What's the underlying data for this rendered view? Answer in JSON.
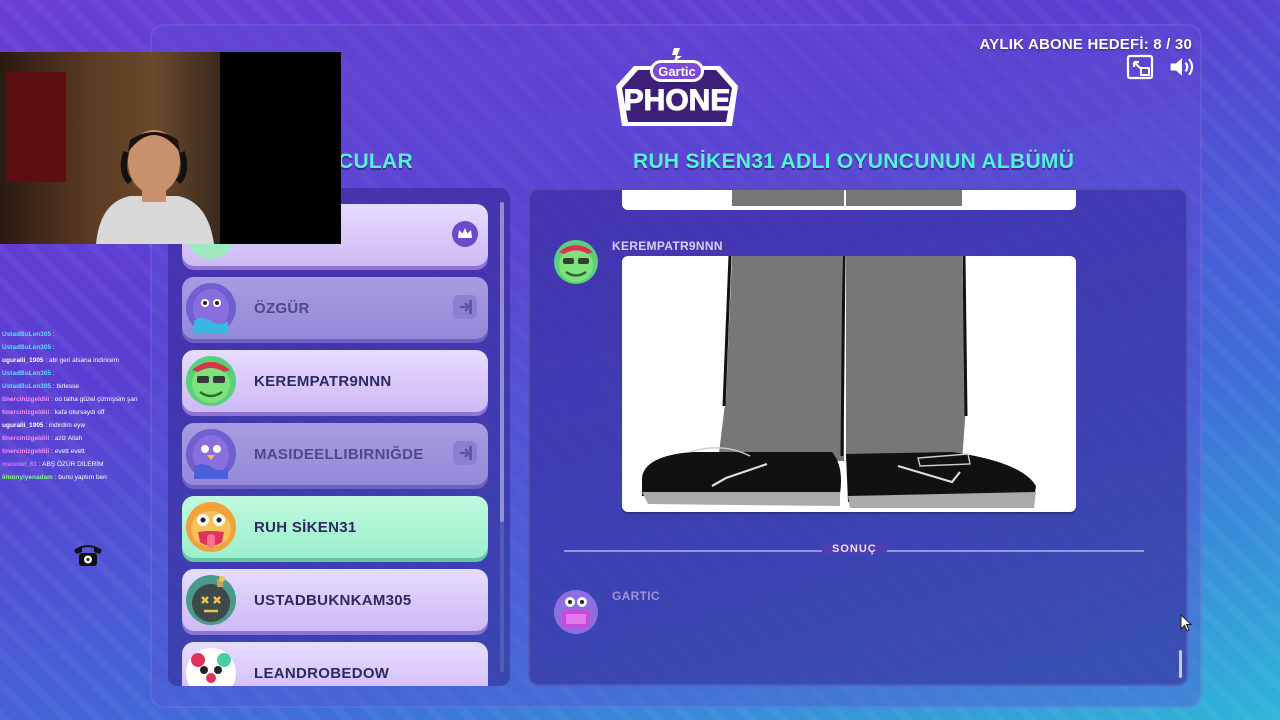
{
  "header": {
    "subscriber_goal": "AYLIK ABONE HEDEFİ: 8 / 30",
    "logo_top": "Gartic",
    "logo_bottom": "PHONE",
    "players_title": "CULAR",
    "album_title": "RUH SİKEN31 ADLI OYUNCUNUN ALBÜMÜ"
  },
  "players": [
    {
      "name": "",
      "state": "host"
    },
    {
      "name": "ÖZGÜR",
      "state": "left"
    },
    {
      "name": "KEREMPATR9NNN",
      "state": "normal"
    },
    {
      "name": "MASIDEELLIBIRNIĞDE",
      "state": "left"
    },
    {
      "name": "RUH SİKEN31",
      "state": "active"
    },
    {
      "name": "USTADBUKNKAM305",
      "state": "normal"
    },
    {
      "name": "LEANDROBEDOW",
      "state": "normal"
    }
  ],
  "album": {
    "entry_author": "KEREMPATR9NNN",
    "result_label": "SONUÇ",
    "result_author": "GARTIC"
  },
  "chat": [
    {
      "user": "UstadBuLen305",
      "msg": ":",
      "color": "#55e0ff"
    },
    {
      "user": "UstadBuLen305",
      "msg": ":",
      "color": "#55e0ff"
    },
    {
      "user": "uguralii_1905",
      "msg": ": abi geri alsana indiricem",
      "color": "#ffffff"
    },
    {
      "user": "UstadBuLen305",
      "msg": ":",
      "color": "#55e0ff"
    },
    {
      "user": "UstadBuLen305",
      "msg": ": birlesse",
      "color": "#55e0ff"
    },
    {
      "user": "tinercinizgeldiii",
      "msg": ": oo talha güzel çizmişsim şan",
      "color": "#ff8cff"
    },
    {
      "user": "tinercinizgeldiii",
      "msg": ": kafa otursaydı off",
      "color": "#ff8cff"
    },
    {
      "user": "uguralii_1905",
      "msg": ": indirdim eyw",
      "color": "#ffffff"
    },
    {
      "user": "tinercinizgeldiii",
      "msg": ": aziz Allah",
      "color": "#ff8cff"
    },
    {
      "user": "tinercinizgeldiii",
      "msg": ": evett evett",
      "color": "#ff8cff"
    },
    {
      "user": "masidel_61",
      "msg": ": ABŞ ÖZÜR DİLERİM",
      "color": "#c080ff"
    },
    {
      "user": "limonyiyenadam",
      "msg": ": bunu yaptım ben",
      "color": "#7dff7d"
    }
  ],
  "colors": {
    "accent_title": "#54f2d8",
    "active_player": "#9cf0cd",
    "player_card": "#e7dcff"
  },
  "icons": [
    "fullscreen-icon",
    "volume-icon",
    "crown-icon",
    "exit-icon",
    "phone-icon",
    "cursor-icon"
  ]
}
